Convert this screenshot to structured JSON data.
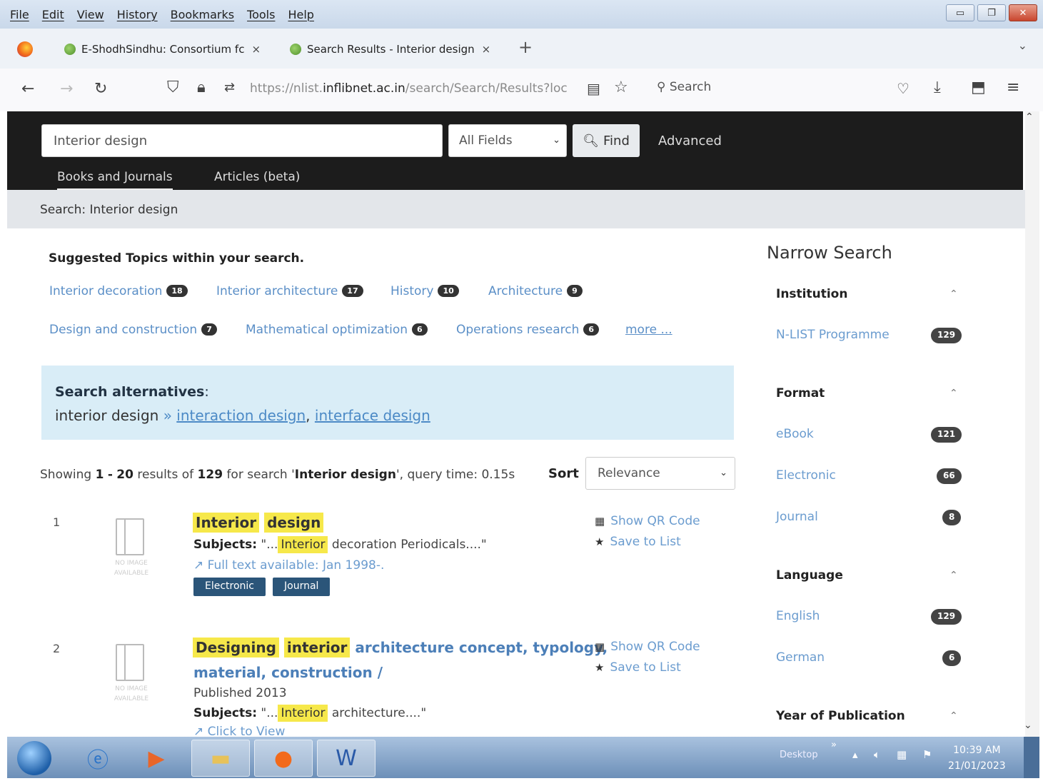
{
  "menu": [
    "File",
    "Edit",
    "View",
    "History",
    "Bookmarks",
    "Tools",
    "Help"
  ],
  "tabs": [
    {
      "label": "E-ShodhSindhu: Consortium fc",
      "close": "×"
    },
    {
      "label": "Search Results - Interior design",
      "close": "×"
    }
  ],
  "new_tab": "+",
  "address": {
    "prefix": "https://nlist.",
    "domain": "inflibnet.ac.in",
    "path": "/search/Search/Results?loc"
  },
  "browser_search_label": "Search",
  "site": {
    "query": "Interior design",
    "field": "All Fields",
    "find_label": "Find",
    "advanced_label": "Advanced",
    "tabs": [
      "Books and Journals",
      "Articles (beta)"
    ]
  },
  "breadcrumb": "Search: Interior design",
  "suggested": {
    "title": "Suggested Topics within your search.",
    "topics": [
      {
        "label": "Interior decoration",
        "count": "18"
      },
      {
        "label": "Interior architecture",
        "count": "17"
      },
      {
        "label": "History",
        "count": "10"
      },
      {
        "label": "Architecture",
        "count": "9"
      },
      {
        "label": "Design and construction",
        "count": "7"
      },
      {
        "label": "Mathematical optimization",
        "count": "6"
      },
      {
        "label": "Operations research",
        "count": "6"
      }
    ],
    "more": "more ..."
  },
  "alternatives": {
    "title": "Search alternatives",
    "colon": ":",
    "term": "interior design",
    "arrow": "»",
    "links": [
      "interaction design",
      "interface design"
    ],
    "sep": ","
  },
  "results_info": {
    "showing": "Showing",
    "start": "1",
    "dash": "-",
    "end": "20",
    "results_of": "results of",
    "total": "129",
    "for_search": "for search '",
    "query": "Interior design",
    "query_time": "', query time: 0.15s"
  },
  "sort": {
    "label": "Sort",
    "value": "Relevance"
  },
  "thumb_caption": [
    "NO IMAGE",
    "AVAILABLE"
  ],
  "results": [
    {
      "num": "1",
      "title_hl": [
        "Interior",
        "design"
      ],
      "subjects_label": "Subjects:",
      "subjects_pre": "\"...",
      "subjects_hl": "Interior",
      "subjects_post": "decoration Periodicals....\"",
      "fulltext": "Full text available: Jan 1998-.",
      "formats": [
        "Electronic",
        "Journal"
      ]
    },
    {
      "num": "2",
      "title_hl": [
        "Designing",
        "interior"
      ],
      "title_rest": "architecture concept, typology,",
      "title_line2": "material, construction /",
      "published": "Published 2013",
      "subjects_label": "Subjects:",
      "subjects_pre": "\"...",
      "subjects_hl": "Interior",
      "subjects_post": "architecture....\"",
      "click_view": "Click to View"
    }
  ],
  "actions": {
    "qr": "Show QR Code",
    "save": "Save to List"
  },
  "sidebar": {
    "title": "Narrow Search",
    "facets": [
      {
        "name": "Institution",
        "items": [
          {
            "label": "N-LIST Programme",
            "count": "129"
          }
        ]
      },
      {
        "name": "Format",
        "items": [
          {
            "label": "eBook",
            "count": "121"
          },
          {
            "label": "Electronic",
            "count": "66"
          },
          {
            "label": "Journal",
            "count": "8"
          }
        ]
      },
      {
        "name": "Language",
        "items": [
          {
            "label": "English",
            "count": "129"
          },
          {
            "label": "German",
            "count": "6"
          }
        ]
      },
      {
        "name": "Year of Publication",
        "items": []
      }
    ]
  },
  "taskbar": {
    "desktop_label": "Desktop",
    "chevron": "»",
    "time": "10:39 AM",
    "date": "21/01/2023"
  }
}
